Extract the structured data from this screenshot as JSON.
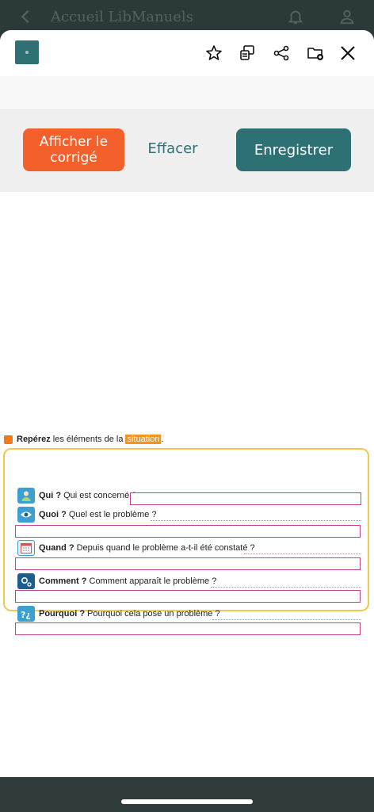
{
  "app_header": {
    "title": "Accueil LibManuels"
  },
  "toolbar": {
    "icons": [
      "document-icon",
      "star-icon",
      "copy-icon",
      "share-icon",
      "folder-add-icon",
      "close-icon"
    ]
  },
  "actions": {
    "show_answer_label": "Afficher le corrigé",
    "clear_label": "Effacer",
    "save_label": "Enregistrer"
  },
  "exercise": {
    "instruction_strong": "Repérez",
    "instruction_text": "les éléments de la",
    "instruction_highlight": "situation",
    "instruction_end": ".",
    "questions": [
      {
        "label": "Qui ?",
        "text": "Qui est concerné ?",
        "icon": "person-icon"
      },
      {
        "label": "Quoi ?",
        "text": "Quel est le problème ?",
        "icon": "eye-icon"
      },
      {
        "label": "Quand ?",
        "text": "Depuis quand le problème a-t-il été constaté ?",
        "icon": "calendar-icon"
      },
      {
        "label": "Comment ?",
        "text": "Comment apparaît le problème ?",
        "icon": "gears-icon"
      },
      {
        "label": "Pourquoi ?",
        "text": "Pourquoi cela pose un problème ?",
        "icon": "question-icon"
      }
    ]
  },
  "colors": {
    "primary_teal": "#2e7175",
    "accent_orange": "#f3602b",
    "answer_border": "#c2418e",
    "frame_yellow": "#f2c94c"
  }
}
